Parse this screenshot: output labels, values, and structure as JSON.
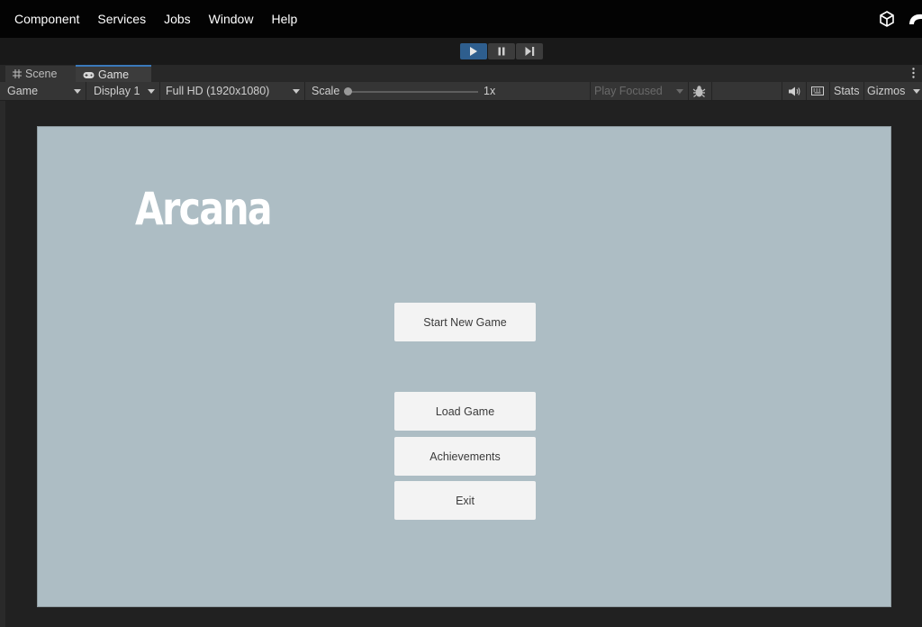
{
  "menubar": {
    "items": [
      "Component",
      "Services",
      "Jobs",
      "Window",
      "Help"
    ],
    "logo_icon": "unity-cube-icon",
    "collab_icon": "collab-cloud-icon"
  },
  "toolbar": {
    "controls": [
      {
        "name": "play",
        "icon": "play-icon",
        "active": true
      },
      {
        "name": "pause",
        "icon": "pause-icon",
        "active": false
      },
      {
        "name": "step",
        "icon": "step-icon",
        "active": false
      }
    ]
  },
  "tabs": [
    {
      "label": "Scene",
      "icon": "grid-icon",
      "selected": false
    },
    {
      "label": "Game",
      "icon": "gamepad-icon",
      "selected": true
    }
  ],
  "gamebar": {
    "view_mode": "Game",
    "display": "Display 1",
    "resolution": "Full HD (1920x1080)",
    "scale_label": "Scale",
    "scale_value": "1x",
    "play_mode": "Play Focused",
    "stats": "Stats",
    "gizmos": "Gizmos"
  },
  "game": {
    "title": "Arcana",
    "buttons": {
      "start": "Start New Game",
      "load": "Load Game",
      "achievements": "Achievements",
      "exit": "Exit"
    }
  },
  "colors": {
    "accent": "#2e5e8e",
    "game_background": "#adbdc4",
    "button_background": "#f3f3f3"
  }
}
